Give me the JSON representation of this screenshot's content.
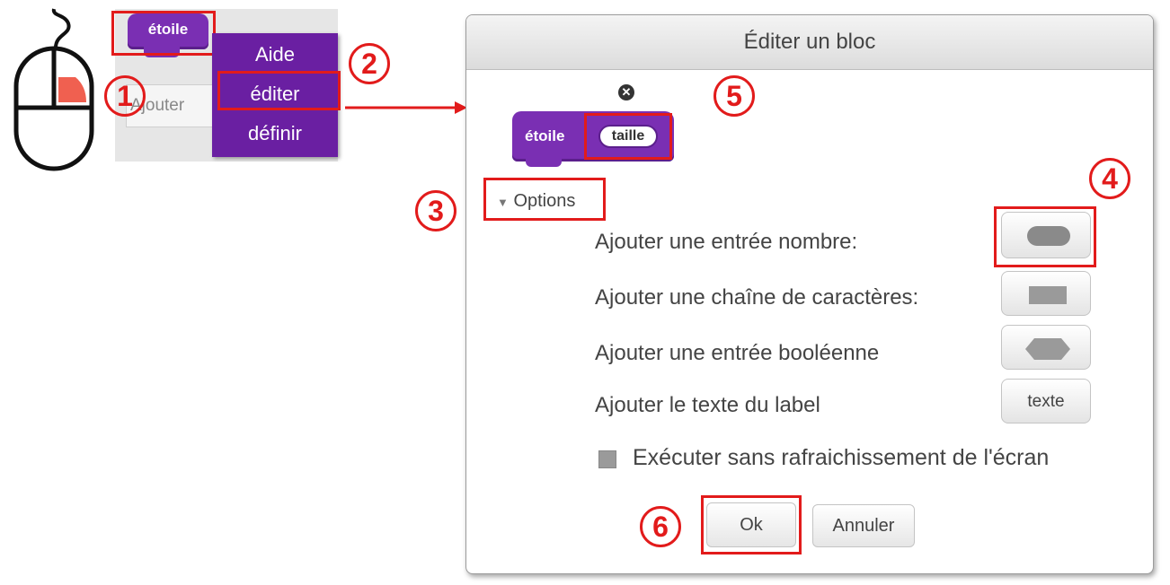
{
  "context": {
    "block_label": "étoile",
    "stub_input_text": "Ajouter",
    "menu_items": [
      "Aide",
      "éditer",
      "définir"
    ]
  },
  "steps": [
    "1",
    "2",
    "3",
    "4",
    "5",
    "6"
  ],
  "dialog": {
    "title": "Éditer un bloc",
    "block_label": "étoile",
    "block_param": "taille",
    "options_label": "Options",
    "options": [
      {
        "label": "Ajouter une entrée nombre:",
        "icon": "rounded-input-icon"
      },
      {
        "label": "Ajouter une chaîne de caractères:",
        "icon": "rect-input-icon"
      },
      {
        "label": "Ajouter une entrée booléenne",
        "icon": "hexagon-input-icon"
      },
      {
        "label": "Ajouter le texte du label",
        "button_text": "texte"
      }
    ],
    "checkbox_label": "Exécuter sans rafraichissement de l'écran",
    "checkbox_checked": false,
    "ok_label": "Ok",
    "cancel_label": "Annuler"
  },
  "colors": {
    "annotation_red": "#e21b1b",
    "block_purple": "#7a2fb3",
    "menu_purple": "#6a1fa2",
    "mouse_button_highlight": "#f06050"
  }
}
